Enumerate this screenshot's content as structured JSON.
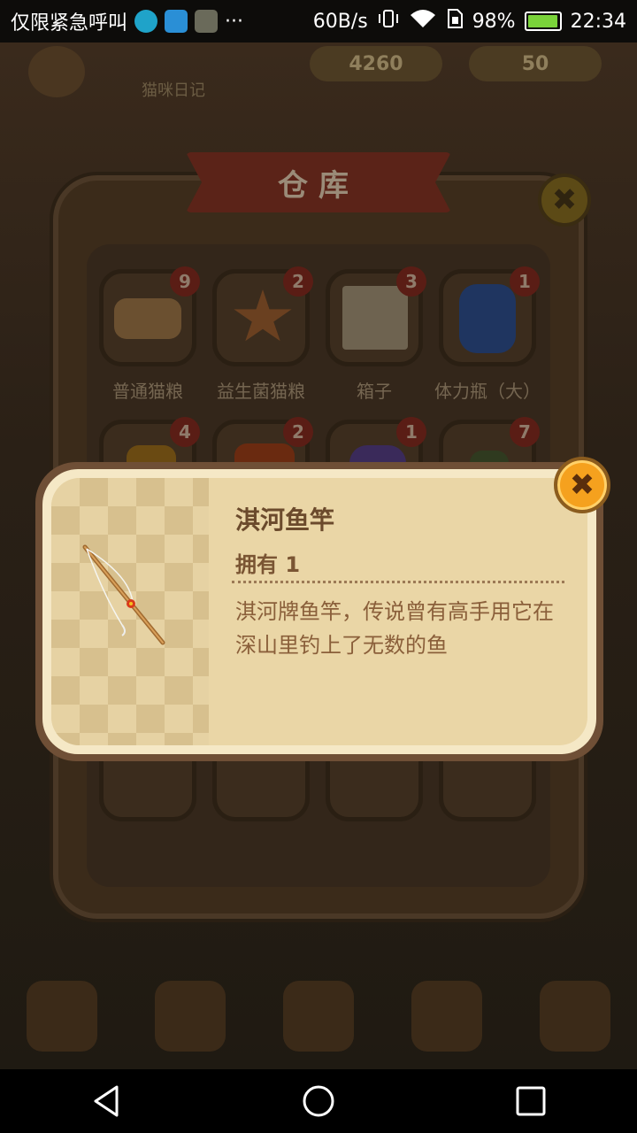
{
  "status_bar": {
    "carrier": "仅限紧急呼叫",
    "more": "···",
    "speed": "60B/s",
    "battery_pct": "98%",
    "battery_level": 0.98,
    "time": "22:34"
  },
  "top_bar": {
    "coins": "4260",
    "gems": "50",
    "diary_label": "猫咪日记"
  },
  "warehouse": {
    "title": "仓库",
    "close_symbol": "✖",
    "items_row1": [
      {
        "name": "普通猫粮",
        "count": "9",
        "icon": "cat-food-icon",
        "color": "#6b5030"
      },
      {
        "name": "益生菌猫粮",
        "count": "2",
        "icon": "star-cookie-icon",
        "color": "#6a4020"
      },
      {
        "name": "箱子",
        "count": "3",
        "icon": "box-icon",
        "color": "#6e6350"
      },
      {
        "name": "体力瓶（大）",
        "count": "1",
        "icon": "bottle-icon",
        "color": "#1f3560"
      }
    ],
    "items_row2": [
      {
        "count": "4",
        "icon": "item-icon",
        "color": "#6a4a12"
      },
      {
        "count": "2",
        "icon": "item-icon",
        "color": "#6a2a10"
      },
      {
        "count": "1",
        "icon": "fish-icon",
        "color": "#3a2a5a"
      },
      {
        "count": "7",
        "icon": "item-icon",
        "color": "#2f3a1f"
      }
    ]
  },
  "popup": {
    "item_name": "淇河鱼竿",
    "owned": "拥有 1",
    "description": "淇河牌鱼竿，传说曾有高手用它在深山里钓上了无数的鱼",
    "close_symbol": "✖",
    "item_icon": "fishing-rod-icon"
  },
  "colors": {
    "popup_bg": "#ead6a6",
    "close_orange": "#f5a11e",
    "badge_red": "#5a1d15"
  }
}
